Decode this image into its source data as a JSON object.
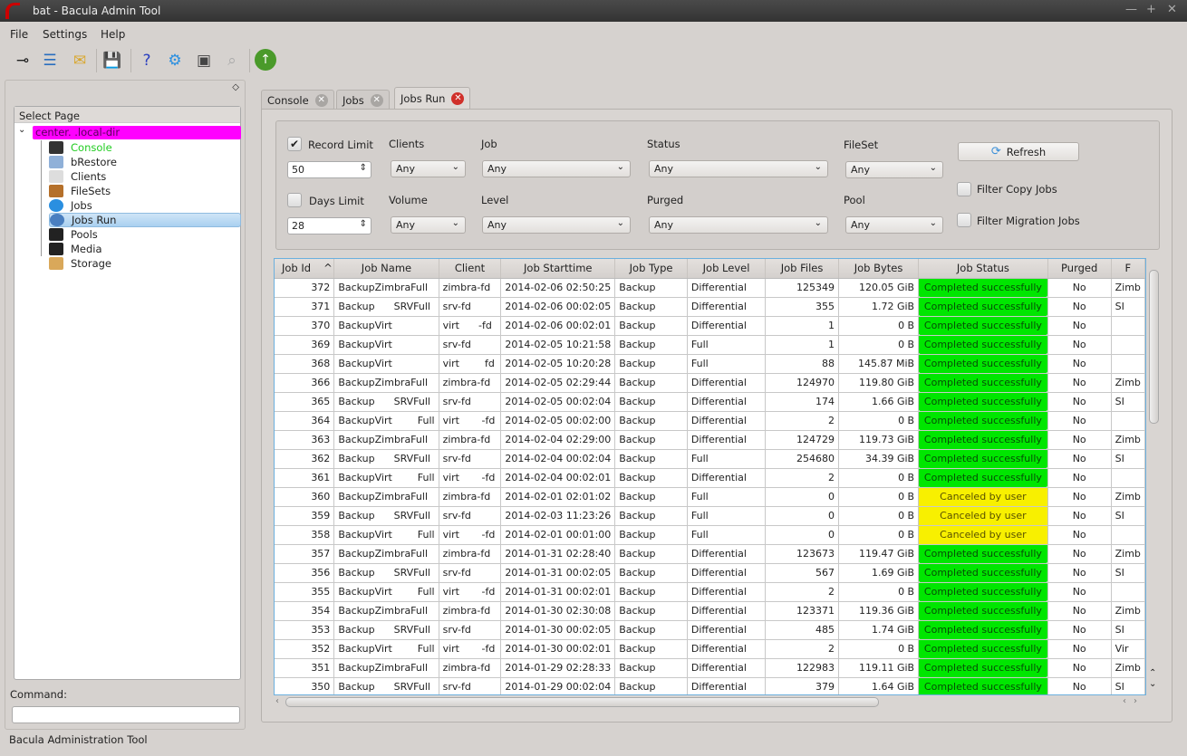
{
  "window": {
    "title": "bat - Bacula Admin Tool"
  },
  "menu": [
    "File",
    "Settings",
    "Help"
  ],
  "toolbar": {
    "icons": [
      "connect-icon",
      "list-icon",
      "label-icon",
      "save-icon",
      "help-config-icon",
      "gear-icon",
      "restore-icon",
      "search-disabled-icon",
      "up-arrow-icon"
    ]
  },
  "sidebar": {
    "header": "Select Page",
    "root": "center.                    .local-dir",
    "items": [
      {
        "label": "Console",
        "color": "#22cc22"
      },
      {
        "label": "bRestore"
      },
      {
        "label": "Clients"
      },
      {
        "label": "FileSets"
      },
      {
        "label": "Jobs"
      },
      {
        "label": "Jobs Run",
        "selected": true
      },
      {
        "label": "Pools"
      },
      {
        "label": "Media"
      },
      {
        "label": "Storage"
      }
    ],
    "command_label": "Command:",
    "command_value": ""
  },
  "statusbar": "Bacula Administration Tool",
  "tabs": [
    {
      "label": "Console"
    },
    {
      "label": "Jobs"
    },
    {
      "label": "Jobs Run",
      "active": true
    }
  ],
  "filters": {
    "record_limit": {
      "label": "Record Limit",
      "checked": true,
      "value": "50"
    },
    "days_limit": {
      "label": "Days Limit",
      "checked": false,
      "value": "28"
    },
    "clients": {
      "label": "Clients",
      "value": "Any"
    },
    "job": {
      "label": "Job",
      "value": "Any"
    },
    "status": {
      "label": "Status",
      "value": "Any"
    },
    "fileset": {
      "label": "FileSet",
      "value": "Any"
    },
    "volume": {
      "label": "Volume",
      "value": "Any"
    },
    "level": {
      "label": "Level",
      "value": "Any"
    },
    "purged": {
      "label": "Purged",
      "value": "Any"
    },
    "pool": {
      "label": "Pool",
      "value": "Any"
    },
    "refresh": "Refresh",
    "filter_copy": "Filter Copy Jobs",
    "filter_migration": "Filter Migration Jobs"
  },
  "table": {
    "columns": [
      "Job Id",
      "Job Name",
      "Client",
      "Job Starttime",
      "Job Type",
      "Job Level",
      "Job Files",
      "Job Bytes",
      "Job Status",
      "Purged",
      "F"
    ],
    "sort_indicator": "^",
    "status_colors": {
      "Completed successfully": "#00e600",
      "Canceled by user": "#f8f000"
    },
    "rows": [
      [
        "372",
        "BackupZimbraFull",
        "zimbra-fd",
        "2014-02-06 02:50:25",
        "Backup",
        "Differential",
        "125349",
        "120.05 GiB",
        "Completed successfully",
        "No",
        "Zimb"
      ],
      [
        "371",
        "Backup      SRVFull",
        "srv-fd",
        "2014-02-06 00:02:05",
        "Backup",
        "Differential",
        "355",
        "1.72 GiB",
        "Completed successfully",
        "No",
        "SI"
      ],
      [
        "370",
        "BackupVirt",
        "virt      -fd",
        "2014-02-06 00:02:01",
        "Backup",
        "Differential",
        "1",
        "0 B",
        "Completed successfully",
        "No",
        ""
      ],
      [
        "369",
        "BackupVirt",
        "srv-fd",
        "2014-02-05 10:21:58",
        "Backup",
        "Full",
        "1",
        "0 B",
        "Completed successfully",
        "No",
        ""
      ],
      [
        "368",
        "BackupVirt",
        "virt        fd",
        "2014-02-05 10:20:28",
        "Backup",
        "Full",
        "88",
        "145.87 MiB",
        "Completed successfully",
        "No",
        ""
      ],
      [
        "366",
        "BackupZimbraFull",
        "zimbra-fd",
        "2014-02-05 02:29:44",
        "Backup",
        "Differential",
        "124970",
        "119.80 GiB",
        "Completed successfully",
        "No",
        "Zimb"
      ],
      [
        "365",
        "Backup      SRVFull",
        "srv-fd",
        "2014-02-05 00:02:04",
        "Backup",
        "Differential",
        "174",
        "1.66 GiB",
        "Completed successfully",
        "No",
        "SI"
      ],
      [
        "364",
        "BackupVirt        Full",
        "virt       -fd",
        "2014-02-05 00:02:00",
        "Backup",
        "Differential",
        "2",
        "0 B",
        "Completed successfully",
        "No",
        ""
      ],
      [
        "363",
        "BackupZimbraFull",
        "zimbra-fd",
        "2014-02-04 02:29:00",
        "Backup",
        "Differential",
        "124729",
        "119.73 GiB",
        "Completed successfully",
        "No",
        "Zimb"
      ],
      [
        "362",
        "Backup      SRVFull",
        "srv-fd",
        "2014-02-04 00:02:04",
        "Backup",
        "Full",
        "254680",
        "34.39 GiB",
        "Completed successfully",
        "No",
        "SI"
      ],
      [
        "361",
        "BackupVirt        Full",
        "virt       -fd",
        "2014-02-04 00:02:01",
        "Backup",
        "Differential",
        "2",
        "0 B",
        "Completed successfully",
        "No",
        ""
      ],
      [
        "360",
        "BackupZimbraFull",
        "zimbra-fd",
        "2014-02-01 02:01:02",
        "Backup",
        "Full",
        "0",
        "0 B",
        "Canceled by user",
        "No",
        "Zimb"
      ],
      [
        "359",
        "Backup      SRVFull",
        "srv-fd",
        "2014-02-03 11:23:26",
        "Backup",
        "Full",
        "0",
        "0 B",
        "Canceled by user",
        "No",
        "SI"
      ],
      [
        "358",
        "BackupVirt        Full",
        "virt       -fd",
        "2014-02-01 00:01:00",
        "Backup",
        "Full",
        "0",
        "0 B",
        "Canceled by user",
        "No",
        ""
      ],
      [
        "357",
        "BackupZimbraFull",
        "zimbra-fd",
        "2014-01-31 02:28:40",
        "Backup",
        "Differential",
        "123673",
        "119.47 GiB",
        "Completed successfully",
        "No",
        "Zimb"
      ],
      [
        "356",
        "Backup      SRVFull",
        "srv-fd",
        "2014-01-31 00:02:05",
        "Backup",
        "Differential",
        "567",
        "1.69 GiB",
        "Completed successfully",
        "No",
        "SI"
      ],
      [
        "355",
        "BackupVirt        Full",
        "virt       -fd",
        "2014-01-31 00:02:01",
        "Backup",
        "Differential",
        "2",
        "0 B",
        "Completed successfully",
        "No",
        ""
      ],
      [
        "354",
        "BackupZimbraFull",
        "zimbra-fd",
        "2014-01-30 02:30:08",
        "Backup",
        "Differential",
        "123371",
        "119.36 GiB",
        "Completed successfully",
        "No",
        "Zimb"
      ],
      [
        "353",
        "Backup      SRVFull",
        "srv-fd",
        "2014-01-30 00:02:05",
        "Backup",
        "Differential",
        "485",
        "1.74 GiB",
        "Completed successfully",
        "No",
        "SI"
      ],
      [
        "352",
        "BackupVirt        Full",
        "virt       -fd",
        "2014-01-30 00:02:01",
        "Backup",
        "Differential",
        "2",
        "0 B",
        "Completed successfully",
        "No",
        "Vir"
      ],
      [
        "351",
        "BackupZimbraFull",
        "zimbra-fd",
        "2014-01-29 02:28:33",
        "Backup",
        "Differential",
        "122983",
        "119.11 GiB",
        "Completed successfully",
        "No",
        "Zimb"
      ],
      [
        "350",
        "Backup      SRVFull",
        "srv-fd",
        "2014-01-29 00:02:04",
        "Backup",
        "Differential",
        "379",
        "1.64 GiB",
        "Completed successfully",
        "No",
        "SI"
      ]
    ]
  }
}
